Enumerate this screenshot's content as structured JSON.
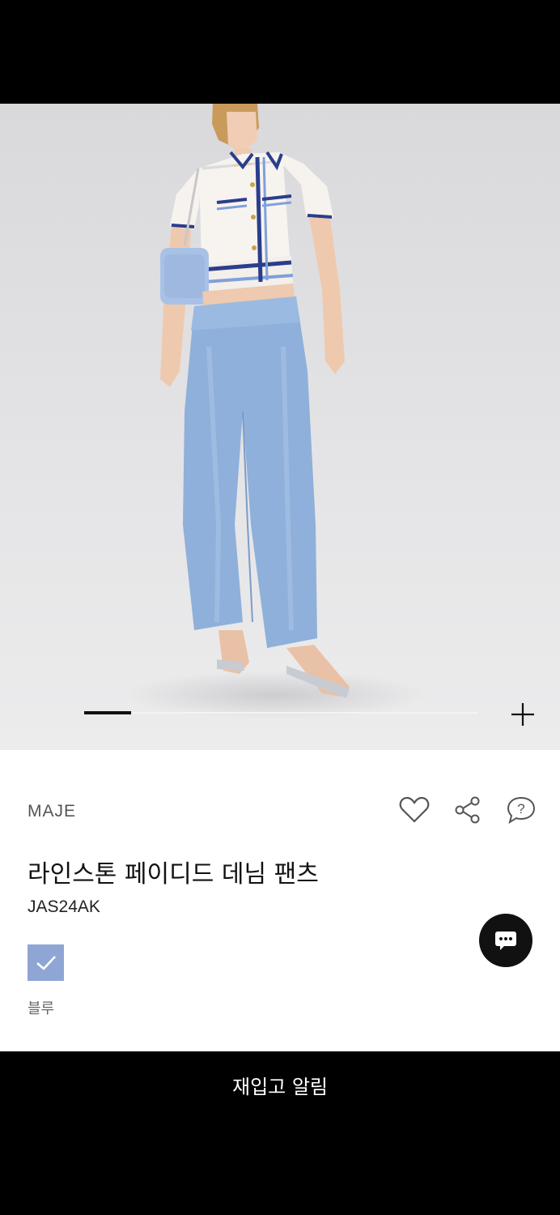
{
  "gallery": {
    "image_alt_icon": "product-photo",
    "progress_fraction": 0.12,
    "zoom_icon": "plus-icon"
  },
  "product": {
    "brand": "MAJE",
    "name": "라인스톤 페이디드 데님 팬츠",
    "code": "JAS24AK",
    "color_label": "블루",
    "color_hex": "#8fa6d4"
  },
  "actions": {
    "wishlist_icon": "heart-icon",
    "share_icon": "share-icon",
    "question_icon": "question-icon"
  },
  "chat": {
    "icon": "chat-dots-icon"
  },
  "footer": {
    "restock_label": "재입고 알림"
  }
}
